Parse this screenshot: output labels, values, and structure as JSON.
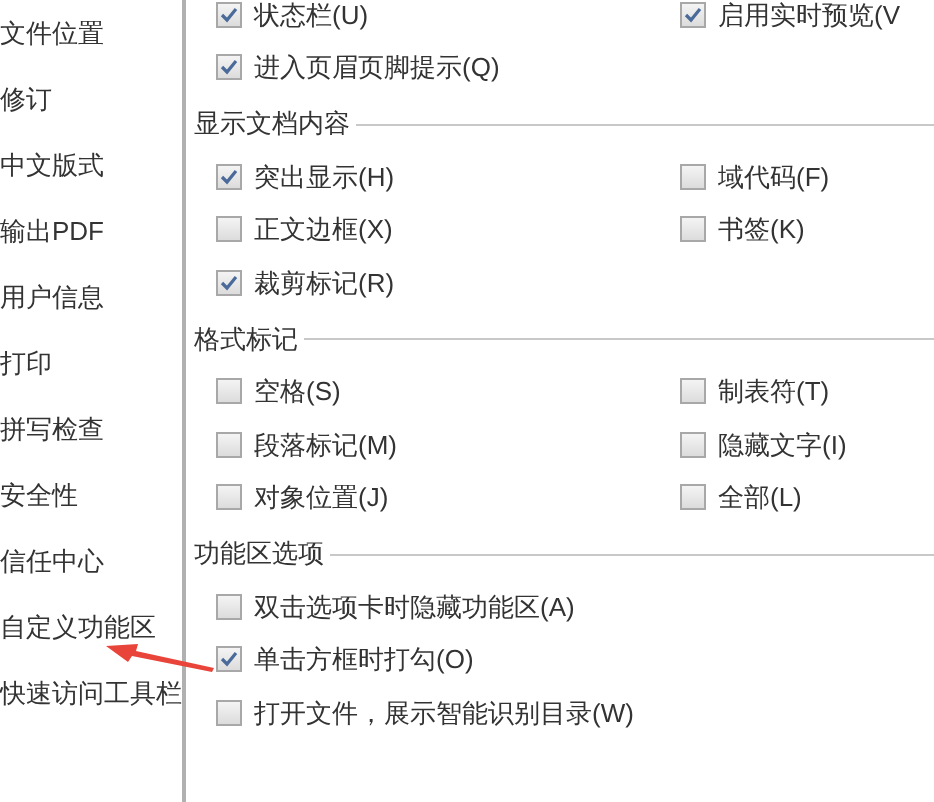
{
  "sidebar": {
    "items": [
      {
        "label": "文件位置",
        "selected": false
      },
      {
        "label": "修订",
        "selected": false
      },
      {
        "label": "中文版式",
        "selected": false
      },
      {
        "label": "输出PDF",
        "selected": false
      },
      {
        "label": "用户信息",
        "selected": false
      },
      {
        "label": "打印",
        "selected": false
      },
      {
        "label": "拼写检查",
        "selected": false
      },
      {
        "label": "安全性",
        "selected": false
      },
      {
        "label": "信任中心",
        "selected": false
      },
      {
        "label": "自定义功能区",
        "selected": false
      },
      {
        "label": "快速访问工具栏",
        "selected": false
      }
    ]
  },
  "top_options": [
    [
      {
        "label": "状态栏(U)",
        "checked": true
      },
      {
        "label": "启用实时预览(V",
        "checked": true
      }
    ],
    [
      {
        "label": "进入页眉页脚提示(Q)",
        "checked": true
      }
    ]
  ],
  "sections": [
    {
      "title": "显示文档内容",
      "rows": [
        [
          {
            "label": "突出显示(H)",
            "checked": true
          },
          {
            "label": "域代码(F)",
            "checked": false
          }
        ],
        [
          {
            "label": "正文边框(X)",
            "checked": false
          },
          {
            "label": "书签(K)",
            "checked": false
          }
        ],
        [
          {
            "label": "裁剪标记(R)",
            "checked": true
          }
        ]
      ]
    },
    {
      "title": "格式标记",
      "rows": [
        [
          {
            "label": "空格(S)",
            "checked": false
          },
          {
            "label": "制表符(T)",
            "checked": false
          }
        ],
        [
          {
            "label": "段落标记(M)",
            "checked": false
          },
          {
            "label": "隐藏文字(I)",
            "checked": false
          }
        ],
        [
          {
            "label": "对象位置(J)",
            "checked": false
          },
          {
            "label": "全部(L)",
            "checked": false
          }
        ]
      ]
    },
    {
      "title": "功能区选项",
      "rows": [
        [
          {
            "label": "双击选项卡时隐藏功能区(A)",
            "checked": false
          }
        ],
        [
          {
            "label": "单击方框时打勾(O)",
            "checked": true
          }
        ],
        [
          {
            "label": "打开文件，展示智能识别目录(W)",
            "checked": false
          }
        ]
      ]
    }
  ]
}
